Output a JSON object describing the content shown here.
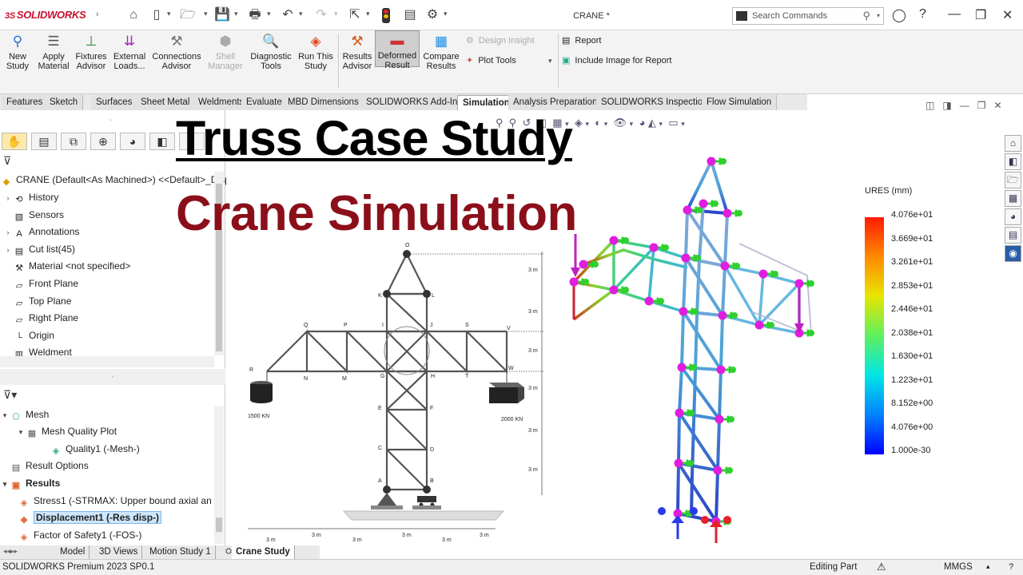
{
  "app": {
    "brand": "SOLIDWORKS",
    "doc_title": "CRANE *",
    "search_placeholder": "Search Commands"
  },
  "ribbon": {
    "new_study": "New\nStudy",
    "apply_material": "Apply\nMaterial",
    "fixtures": "Fixtures\nAdvisor",
    "external_loads": "External\nLoads...",
    "connections": "Connections\nAdvisor",
    "shell_manager": "Shell\nManager",
    "diagnostic": "Diagnostic\nTools",
    "run_study": "Run This\nStudy",
    "results_advisor": "Results\nAdvisor",
    "deformed_result": "Deformed\nResult",
    "compare_results": "Compare\nResults",
    "design_insight": "Design Insight",
    "plot_tools": "Plot Tools",
    "report": "Report",
    "include_image": "Include Image for Report"
  },
  "tabs": [
    "Features",
    "Sketch",
    "Surfaces",
    "Sheet Metal",
    "Weldments",
    "Evaluate",
    "MBD Dimensions",
    "SOLIDWORKS Add-Ins",
    "Simulation",
    "Analysis Preparation",
    "SOLIDWORKS Inspection",
    "Flow Simulation"
  ],
  "tree": {
    "root": "CRANE (Default<As Machined>) <<Default>_Disp",
    "items": [
      "History",
      "Sensors",
      "Annotations",
      "Cut list(45)",
      "Material <not specified>",
      "Front Plane",
      "Top Plane",
      "Right Plane",
      "Origin",
      "Weldment"
    ]
  },
  "sim_tree": {
    "mesh": "Mesh",
    "mesh_quality_plot": "Mesh Quality Plot",
    "quality1": "Quality1 (-Mesh-)",
    "result_options": "Result Options",
    "results": "Results",
    "stress1": "Stress1 (-STRMAX: Upper bound axial an",
    "displacement1": "Displacement1 (-Res disp-)",
    "fos1": "Factor of Safety1 (-FOS-)"
  },
  "bottom_tabs": [
    "Model",
    "3D Views",
    "Motion Study 1",
    "Crane Study"
  ],
  "status": {
    "left": "SOLIDWORKS Premium 2023 SP0.1",
    "mode": "Editing Part",
    "units": "MMGS"
  },
  "overlay": {
    "title": "Truss Case Study",
    "subtitle": "Crane Simulation"
  },
  "diagram": {
    "nodes": [
      "O",
      "K",
      "L",
      "Q",
      "P",
      "I",
      "J",
      "S",
      "V",
      "R",
      "N",
      "M",
      "G",
      "H",
      "T",
      "W",
      "E",
      "F",
      "C",
      "D",
      "A",
      "B"
    ],
    "dims_right": [
      "3 m",
      "3 m",
      "3 m",
      "3 m",
      "3 m",
      "3 m"
    ],
    "dims_bottom": [
      "3 m",
      "3 m",
      "3 m",
      "3 m",
      "3 m",
      "3 m"
    ],
    "load_left": "1500 KN",
    "load_right": "2000 KN"
  },
  "legend": {
    "title": "URES (mm)",
    "labels": [
      "4.076e+01",
      "3.669e+01",
      "3.261e+01",
      "2.853e+01",
      "2.446e+01",
      "2.038e+01",
      "1.630e+01",
      "1.223e+01",
      "8.152e+00",
      "4.076e+00",
      "1.000e-30"
    ]
  },
  "colors": {
    "accent": "#c8102e",
    "title2": "#8b0f1a",
    "node": "#e11de0",
    "arrow": "#2ed12e"
  }
}
